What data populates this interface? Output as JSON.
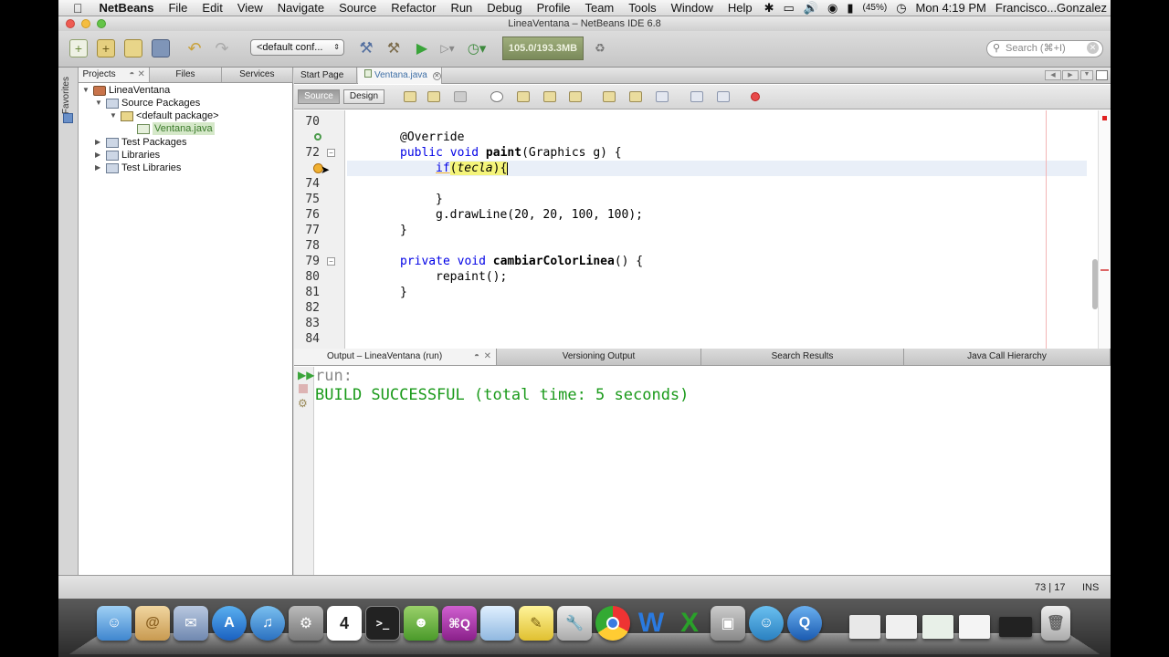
{
  "menubar": {
    "app_name": "NetBeans",
    "items": [
      "File",
      "Edit",
      "View",
      "Navigate",
      "Source",
      "Refactor",
      "Run",
      "Debug",
      "Profile",
      "Team",
      "Tools",
      "Window",
      "Help"
    ],
    "battery": "(45%)",
    "clock": "Mon 4:19 PM",
    "user": "Francisco...Gonzalez"
  },
  "window": {
    "title": "LineaVentana – NetBeans IDE 6.8"
  },
  "toolbar": {
    "config_select": "<default conf...",
    "memory": "105.0/193.3MB",
    "search_placeholder": "Search (⌘+I)"
  },
  "left_strip": {
    "favorites": "Favorites"
  },
  "projects_panel": {
    "tabs": [
      "Projects",
      "Files",
      "Services"
    ],
    "tree": [
      {
        "label": "LineaVentana"
      },
      {
        "label": "Source Packages"
      },
      {
        "label": "<default package>"
      },
      {
        "label": "Ventana.java"
      },
      {
        "label": "Test Packages"
      },
      {
        "label": "Libraries"
      },
      {
        "label": "Test Libraries"
      }
    ]
  },
  "editor": {
    "tabs": [
      "Start Page",
      "Ventana.java"
    ],
    "mode_buttons": [
      "Source",
      "Design"
    ],
    "line_numbers": [
      "70",
      "",
      "72",
      "",
      "74",
      "75",
      "76",
      "77",
      "78",
      "79",
      "80",
      "81",
      "82",
      "83",
      "84"
    ],
    "lines": {
      "l71": "@Override",
      "l72_kw": "public void ",
      "l72_name": "paint",
      "l72_rest": "(Graphics g) {",
      "l73_kw": "if",
      "l73_open": "(",
      "l73_var": "tecla",
      "l73_close": "){",
      "l75": "}",
      "l76": "g.drawLine(20, 20, 100, 100);",
      "l77": "}",
      "l79_kw": "private void ",
      "l79_name": "cambiarColorLinea",
      "l79_rest": "() {",
      "l80": "repaint();",
      "l81": "}"
    }
  },
  "output": {
    "tabs": [
      "Output – LineaVentana (run)",
      "Versioning Output",
      "Search Results",
      "Java Call Hierarchy"
    ],
    "line1": "run:",
    "line2": "BUILD SUCCESSFUL (total time: 5 seconds)"
  },
  "statusbar": {
    "position": "73 | 17",
    "mode": "INS"
  },
  "dock": {
    "calendar_day": "4",
    "cmdquit": "⌘Q"
  }
}
